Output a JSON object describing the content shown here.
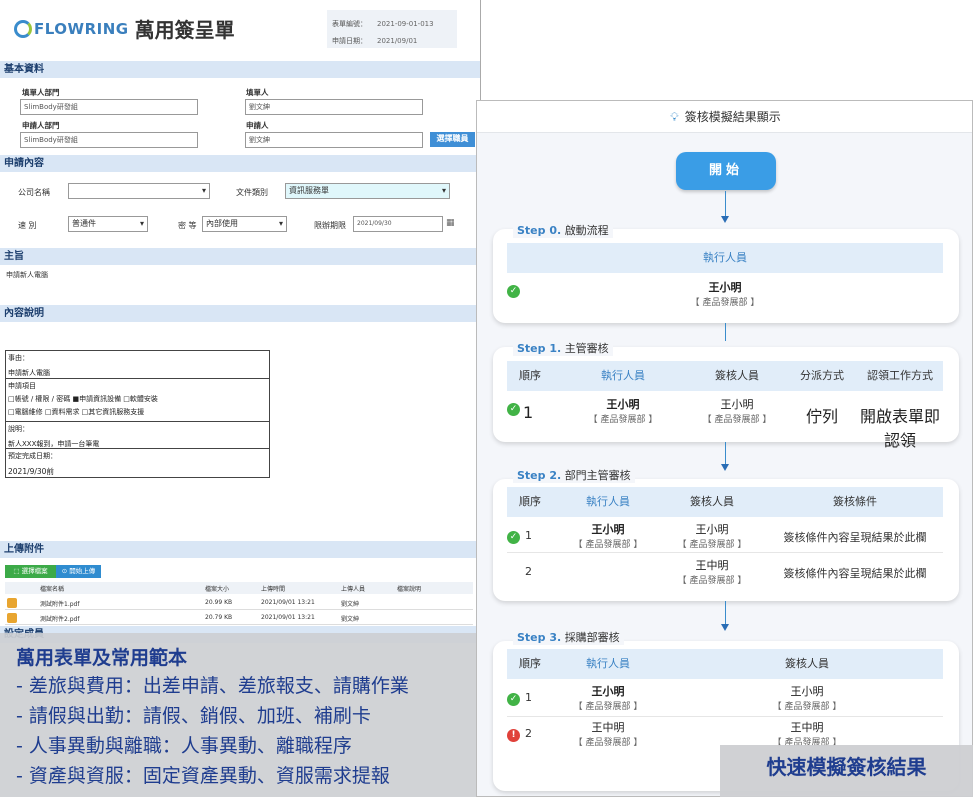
{
  "form": {
    "brand": "FLOWRING",
    "title": "萬用簽呈單",
    "meta_no_label": "表單編號：",
    "meta_no": "2021-09-01-013",
    "meta_date_label": "申請日期：",
    "meta_date": "2021/09/01",
    "sec_basic": "基本資料",
    "fill_dept_label": "填單人部門",
    "fill_dept": "SlimBody研發組",
    "filler_label": "填單人",
    "filler": "劉文紳",
    "apply_dept_label": "申請人部門",
    "apply_dept": "SlimBody研發組",
    "applicant_label": "申請人",
    "applicant": "劉文紳",
    "pick_staff": "選擇職員",
    "sec_content": "申請內容",
    "company_label": "公司名稱",
    "company": "",
    "doctype_label": "文件類別",
    "doctype": "資訊服務單",
    "speed_label": "速 別",
    "speed": "普通件",
    "secret_label": "密 等",
    "secret": "內部使用",
    "deadline_label": "限辦期限",
    "deadline": "2021/09/30",
    "sec_subject": "主旨",
    "subject": "申請新人電腦",
    "sec_desc": "內容說明",
    "desc_reason_label": "事由：",
    "desc_reason": "申請新人電腦",
    "desc_items_label": "申請項目",
    "desc_items_1": "□帳號 / 權限 / 密碼 ■申請資訊設備 □軟體安裝",
    "desc_items_2": "□電腦維修 □資料需求 □其它資訊服務支援",
    "desc_note_label": "說明：",
    "desc_note": "新人XXX報到，申請一台筆電",
    "desc_due_label": "預定完成日期：",
    "desc_due": "2021/9/30前",
    "sec_upload": "上傳附件",
    "btn_select": "選擇檔案",
    "btn_upload": "開始上傳",
    "cols": [
      "檔案名稱",
      "檔案大小",
      "上傳時間",
      "上傳人員",
      "檔案說明"
    ],
    "files": [
      {
        "name": "測試附件1.pdf",
        "size": "20.99 KB",
        "time": "2021/09/01 13:21",
        "user": "劉文紳"
      },
      {
        "name": "測試附件2.pdf",
        "size": "20.79 KB",
        "time": "2021/09/01 13:21",
        "user": "劉文紳"
      }
    ],
    "sec_members": "設定成員"
  },
  "overlay": {
    "title": "萬用表單及常用範本",
    "lines": [
      "- 差旅與費用：出差申請、差旅報支、請購作業",
      "- 請假與出勤：請假、銷假、加班、補刷卡",
      "- 人事異動與離職：人事異動、離職程序",
      "- 資產與資服：固定資產異動、資服需求提報"
    ]
  },
  "panel": {
    "title": "簽核模擬結果顯示",
    "start": "開始",
    "step0": {
      "num": "Step 0.",
      "name": "啟動流程",
      "col": "執行人員",
      "person": "王小明",
      "dept": "【 產品發展部 】"
    },
    "step1": {
      "num": "Step 1.",
      "name": "主管審核",
      "cols": [
        "順序",
        "執行人員",
        "簽核人員",
        "分派方式",
        "認領工作方式"
      ],
      "row": {
        "seq": "1",
        "exec": "王小明",
        "exec_dept": "【 產品發展部 】",
        "sign": "王小明",
        "sign_dept": "【 產品發展部 】",
        "assign": "佇列",
        "claim": "開啟表單即認領"
      }
    },
    "step2": {
      "num": "Step 2.",
      "name": "部門主管審核",
      "cols": [
        "順序",
        "執行人員",
        "簽核人員",
        "簽核條件"
      ],
      "rows": [
        {
          "seq": "1",
          "exec": "王小明",
          "exec_dept": "【 產品發展部 】",
          "sign": "王小明",
          "sign_dept": "【 產品發展部 】",
          "cond": "簽核條件內容呈現結果於此欄"
        },
        {
          "seq": "2",
          "sign": "王中明",
          "sign_dept": "【 產品發展部 】",
          "cond": "簽核條件內容呈現結果於此欄"
        }
      ]
    },
    "step3": {
      "num": "Step 3.",
      "name": "採購部審核",
      "cols": [
        "順序",
        "執行人員",
        "簽核人員"
      ],
      "rows": [
        {
          "seq": "1",
          "exec": "王小明",
          "exec_dept": "【 產品發展部 】",
          "sign": "王小明",
          "sign_dept": "【 產品發展部 】"
        },
        {
          "seq": "2",
          "exec": "王中明",
          "exec_dept": "【 產品發展部 】",
          "sign": "王中明",
          "sign_dept": "【 產品發展部 】"
        }
      ]
    }
  },
  "caption": "快速模擬簽核結果"
}
